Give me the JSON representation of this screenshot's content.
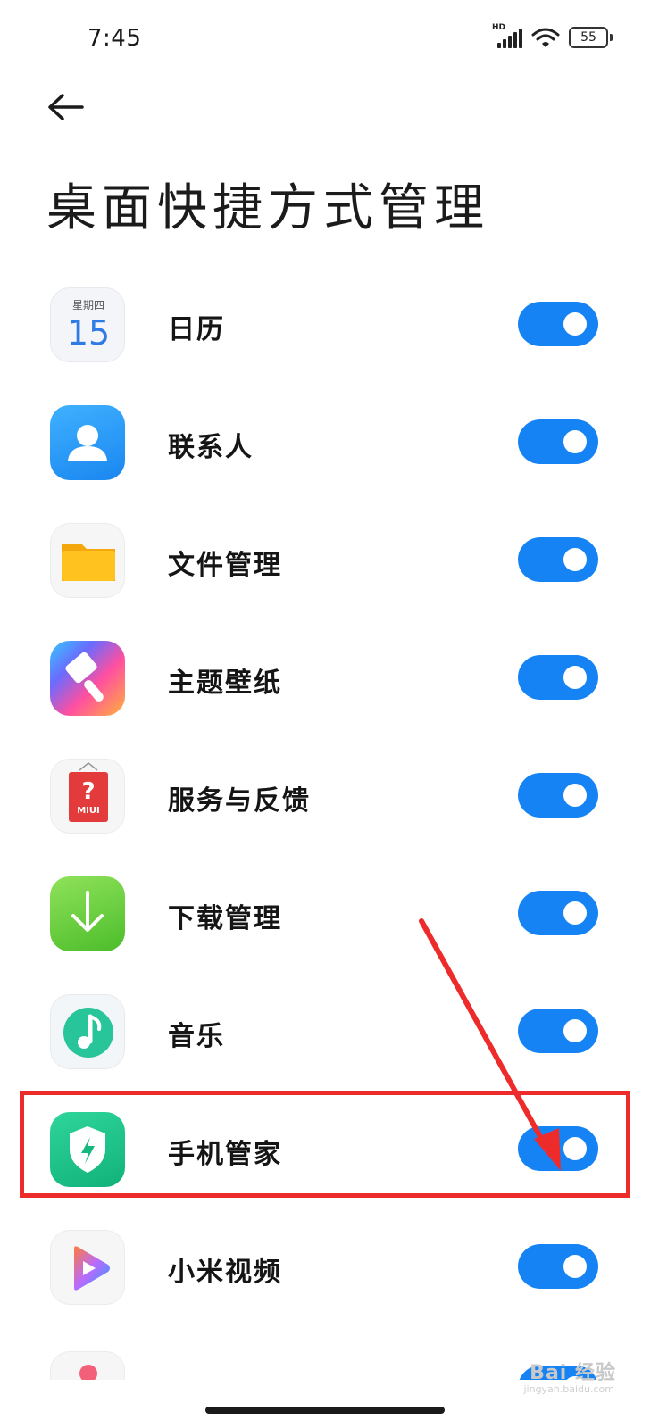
{
  "status_bar": {
    "time": "7:45",
    "network": "HD",
    "battery": "55"
  },
  "header": {
    "back_icon": "arrow-left-icon",
    "title": "桌面快捷方式管理"
  },
  "items": [
    {
      "label": "日历",
      "icon": "calendar-icon",
      "icon_day": "星期四",
      "icon_date": "15",
      "enabled": true
    },
    {
      "label": "联系人",
      "icon": "contacts-icon",
      "enabled": true
    },
    {
      "label": "文件管理",
      "icon": "folder-icon",
      "enabled": true
    },
    {
      "label": "主题壁纸",
      "icon": "theme-brush-icon",
      "enabled": true
    },
    {
      "label": "服务与反馈",
      "icon": "service-feedback-icon",
      "icon_badge": "MIUI",
      "enabled": true
    },
    {
      "label": "下载管理",
      "icon": "download-icon",
      "enabled": true
    },
    {
      "label": "音乐",
      "icon": "music-note-icon",
      "enabled": true
    },
    {
      "label": "手机管家",
      "icon": "security-shield-icon",
      "enabled": true
    },
    {
      "label": "小米视频",
      "icon": "video-play-icon",
      "enabled": true
    }
  ],
  "annotation": {
    "highlighted_item": "手机管家",
    "color": "#ee2b2b"
  },
  "colors": {
    "toggle_on": "#1683f5",
    "background": "#ffffff"
  },
  "watermark": {
    "text": "Bai 经验",
    "sub": "jingyan.baidu.com"
  }
}
